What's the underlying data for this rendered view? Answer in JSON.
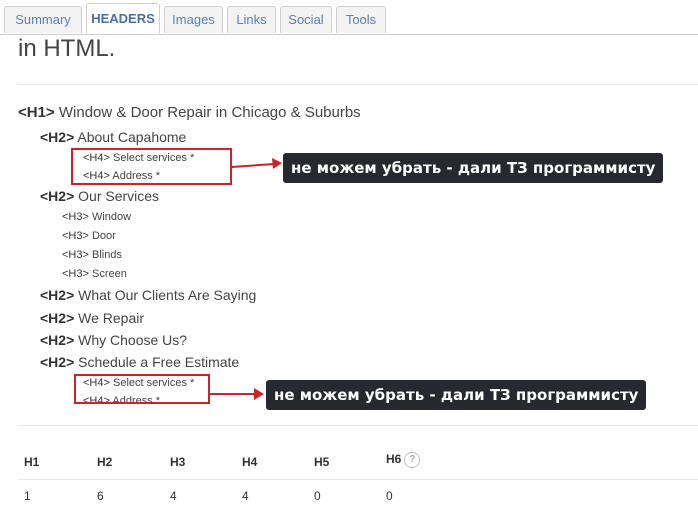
{
  "tabs": [
    {
      "label": "Summary"
    },
    {
      "label": "HEADERS"
    },
    {
      "label": "Images"
    },
    {
      "label": "Links"
    },
    {
      "label": "Social"
    },
    {
      "label": "Tools"
    }
  ],
  "intro_text": "in HTML.",
  "headings": [
    {
      "tag": "<H1>",
      "text": "Window & Door Repair in Chicago & Suburbs"
    },
    {
      "tag": "<H2>",
      "text": "About Capahome"
    },
    {
      "tag": "<H4>",
      "text": "Select services *"
    },
    {
      "tag": "<H4>",
      "text": "Address *"
    },
    {
      "tag": "<H2>",
      "text": "Our Services"
    },
    {
      "tag": "<H3>",
      "text": "Window"
    },
    {
      "tag": "<H3>",
      "text": "Door"
    },
    {
      "tag": "<H3>",
      "text": "Blinds"
    },
    {
      "tag": "<H3>",
      "text": "Screen"
    },
    {
      "tag": "<H2>",
      "text": "What Our Clients Are Saying"
    },
    {
      "tag": "<H2>",
      "text": "We Repair"
    },
    {
      "tag": "<H2>",
      "text": "Why Choose Us?"
    },
    {
      "tag": "<H2>",
      "text": "Schedule a Free Estimate"
    },
    {
      "tag": "<H4>",
      "text": "Select services *"
    },
    {
      "tag": "<H4>",
      "text": "Address *"
    }
  ],
  "annotations": [
    {
      "text": "не можем убрать - дали ТЗ программисту"
    },
    {
      "text": "не можем убрать - дали ТЗ программисту"
    }
  ],
  "stats": {
    "headers": [
      "H1",
      "H2",
      "H3",
      "H4",
      "H5",
      "H6"
    ],
    "values": [
      "1",
      "6",
      "4",
      "4",
      "0",
      "0"
    ],
    "help_icon": "?"
  },
  "colors": {
    "annotation_bg": "#262a30",
    "highlight": "#d0202a",
    "tab_text": "#5c7fb6"
  }
}
